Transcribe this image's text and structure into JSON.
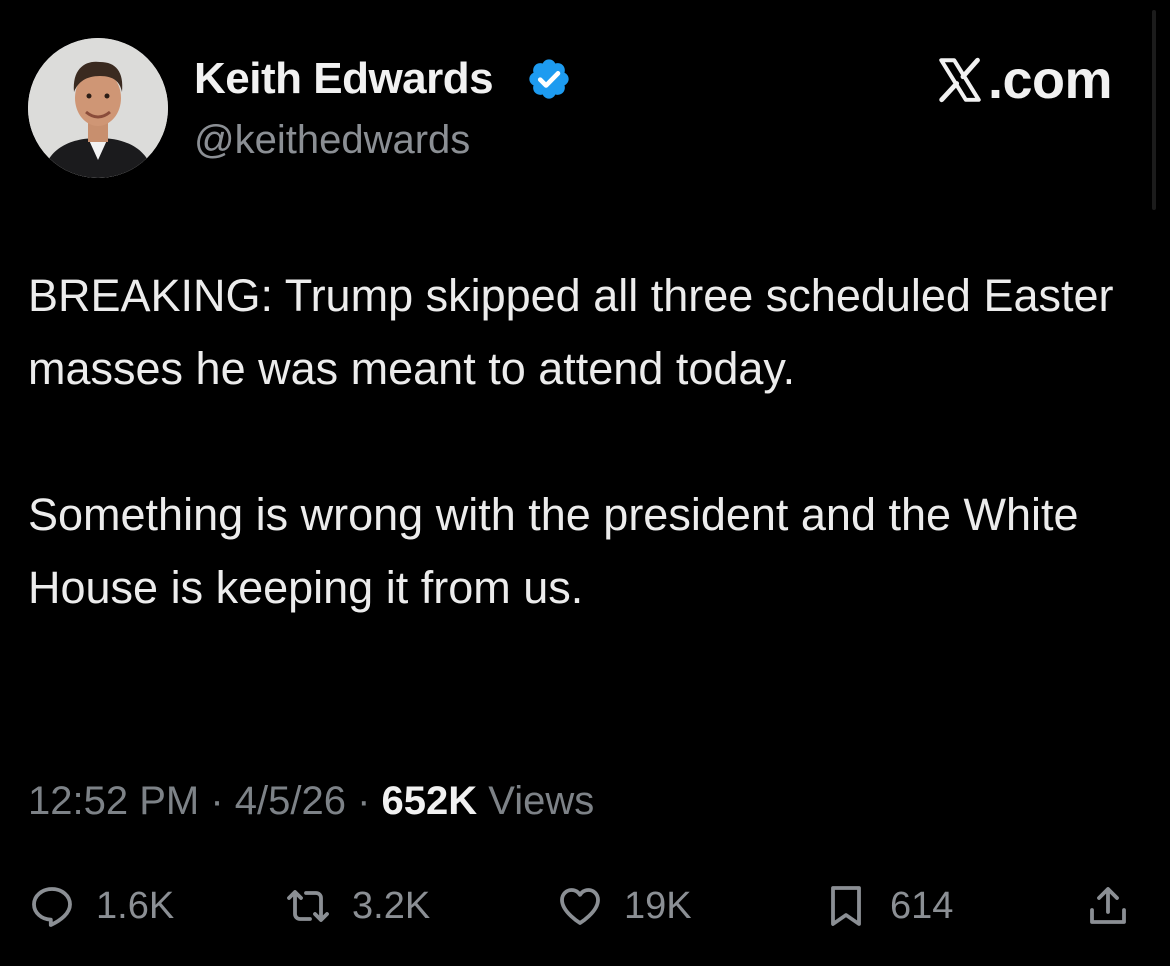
{
  "author": {
    "display_name": "Keith Edwards",
    "handle": "@keithedwards",
    "verified": true,
    "avatar": "profile-photo"
  },
  "brand": {
    "text": ".com",
    "logo": "x-logo"
  },
  "tweet": {
    "paragraphs": [
      "BREAKING: Trump skipped all three scheduled Easter masses he was meant to attend today.",
      "Something is wrong with the president and the White House is keeping it from us."
    ]
  },
  "meta": {
    "time": "12:52 PM",
    "sep1": " · ",
    "date": "4/5/26",
    "sep2": " · ",
    "views_count": "652K",
    "views_label": " Views"
  },
  "actions": {
    "replies": "1.6K",
    "reposts": "3.2K",
    "likes": "19K",
    "bookmarks": "614"
  },
  "colors": {
    "background": "#000000",
    "text": "#e7e9ea",
    "muted": "#8b8f94",
    "verified_badge": "#1d9bf0"
  },
  "icons": [
    "verified-badge-icon",
    "x-logo-icon",
    "reply-icon",
    "repost-icon",
    "like-icon",
    "bookmark-icon",
    "share-icon"
  ]
}
